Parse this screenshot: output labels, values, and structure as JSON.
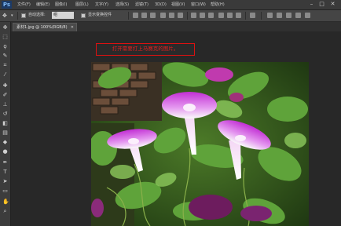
{
  "app": {
    "logo": "Ps"
  },
  "menubar": {
    "items": [
      "文件(F)",
      "编辑(E)",
      "图像(I)",
      "图层(L)",
      "文字(Y)",
      "选择(S)",
      "滤镜(T)",
      "3D(D)",
      "视图(V)",
      "窗口(W)",
      "帮助(H)"
    ],
    "window_controls": [
      "–",
      "□",
      "✕"
    ]
  },
  "options_bar": {
    "auto_select_label": "自动选择:",
    "auto_select_value": "组",
    "show_transform_label": "显示变换控件"
  },
  "document": {
    "tab_title": "素材1.jpg @ 100%(RGB/8)"
  },
  "annotation": {
    "text": "打开需要打上马赛克的图片。"
  },
  "icons": {
    "tools": [
      "move-icon",
      "marquee-icon",
      "lasso-icon",
      "quick-select-icon",
      "crop-icon",
      "eyedropper-icon",
      "healing-icon",
      "brush-icon",
      "stamp-icon",
      "history-brush-icon",
      "eraser-icon",
      "gradient-icon",
      "blur-icon",
      "dodge-icon",
      "pen-icon",
      "type-icon",
      "path-select-icon",
      "shape-icon",
      "hand-icon",
      "zoom-icon"
    ]
  },
  "colors": {
    "accent_red": "#e02020",
    "panel_dark": "#2b2b2b"
  }
}
